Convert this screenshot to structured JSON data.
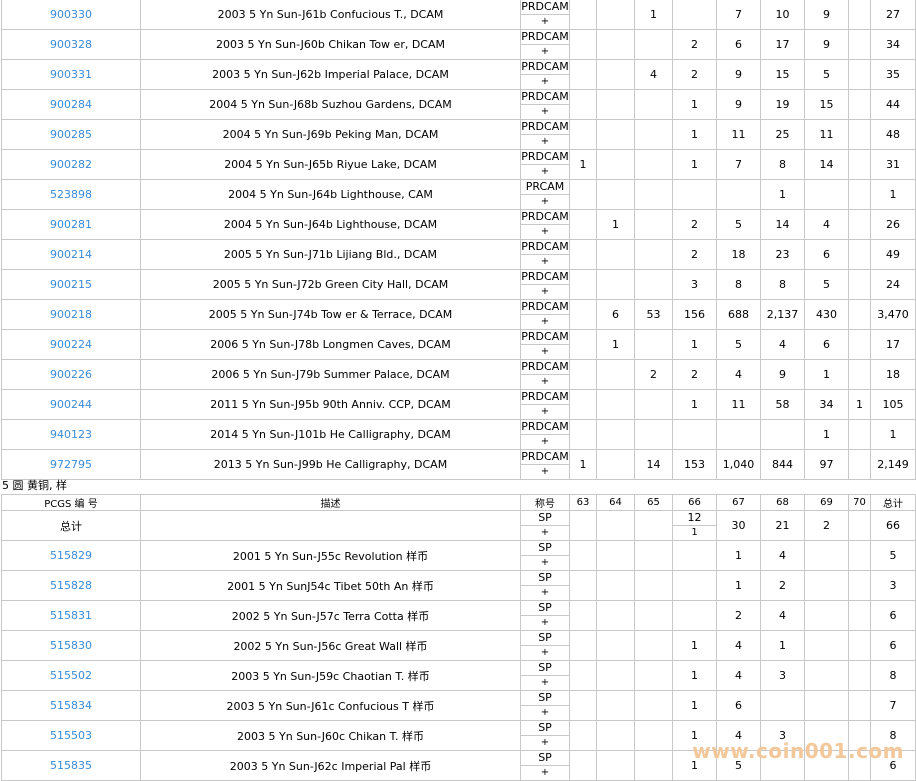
{
  "table1": {
    "rows": [
      {
        "pcgs": "900330",
        "desc": "2003 5 Yn Sun-J61b Confucious T., DCAM",
        "grade": "PRDCAM",
        "plus": "+",
        "c63": "",
        "c64": "",
        "c65": "1",
        "c66": "",
        "c67": "7",
        "c68": "10",
        "c69": "9",
        "c70": "",
        "total": "27"
      },
      {
        "pcgs": "900328",
        "desc": "2003 5 Yn Sun-J60b Chikan Tow er, DCAM",
        "grade": "PRDCAM",
        "plus": "+",
        "c63": "",
        "c64": "",
        "c65": "",
        "c66": "2",
        "c67": "6",
        "c68": "17",
        "c69": "9",
        "c70": "",
        "total": "34"
      },
      {
        "pcgs": "900331",
        "desc": "2003 5 Yn Sun-J62b Imperial Palace, DCAM",
        "grade": "PRDCAM",
        "plus": "+",
        "c63": "",
        "c64": "",
        "c65": "4",
        "c66": "2",
        "c67": "9",
        "c68": "15",
        "c69": "5",
        "c70": "",
        "total": "35"
      },
      {
        "pcgs": "900284",
        "desc": "2004 5 Yn Sun-J68b Suzhou Gardens, DCAM",
        "grade": "PRDCAM",
        "plus": "+",
        "c63": "",
        "c64": "",
        "c65": "",
        "c66": "1",
        "c67": "9",
        "c68": "19",
        "c69": "15",
        "c70": "",
        "total": "44"
      },
      {
        "pcgs": "900285",
        "desc": "2004 5 Yn Sun-J69b Peking Man, DCAM",
        "grade": "PRDCAM",
        "plus": "+",
        "c63": "",
        "c64": "",
        "c65": "",
        "c66": "1",
        "c67": "11",
        "c68": "25",
        "c69": "11",
        "c70": "",
        "total": "48"
      },
      {
        "pcgs": "900282",
        "desc": "2004 5 Yn Sun-J65b Riyue Lake, DCAM",
        "grade": "PRDCAM",
        "plus": "+",
        "c63": "1",
        "c64": "",
        "c65": "",
        "c66": "1",
        "c67": "7",
        "c68": "8",
        "c69": "14",
        "c70": "",
        "total": "31"
      },
      {
        "pcgs": "523898",
        "desc": "2004 5 Yn Sun-J64b Lighthouse, CAM",
        "grade": "PRCAM",
        "plus": "+",
        "c63": "",
        "c64": "",
        "c65": "",
        "c66": "",
        "c67": "",
        "c68": "1",
        "c69": "",
        "c70": "",
        "total": "1"
      },
      {
        "pcgs": "900281",
        "desc": "2004 5 Yn Sun-J64b Lighthouse, DCAM",
        "grade": "PRDCAM",
        "plus": "+",
        "c63": "",
        "c64": "1",
        "c65": "",
        "c66": "2",
        "c67": "5",
        "c68": "14",
        "c69": "4",
        "c70": "",
        "total": "26"
      },
      {
        "pcgs": "900214",
        "desc": "2005 5 Yn Sun-J71b Lijiang Bld., DCAM",
        "grade": "PRDCAM",
        "plus": "+",
        "c63": "",
        "c64": "",
        "c65": "",
        "c66": "2",
        "c67": "18",
        "c68": "23",
        "c69": "6",
        "c70": "",
        "total": "49"
      },
      {
        "pcgs": "900215",
        "desc": "2005 5 Yn Sun-J72b Green City Hall, DCAM",
        "grade": "PRDCAM",
        "plus": "+",
        "c63": "",
        "c64": "",
        "c65": "",
        "c66": "3",
        "c67": "8",
        "c68": "8",
        "c69": "5",
        "c70": "",
        "total": "24"
      },
      {
        "pcgs": "900218",
        "desc": "2005 5 Yn Sun-J74b Tow er & Terrace, DCAM",
        "grade": "PRDCAM",
        "plus": "+",
        "c63": "",
        "c64": "6",
        "c65": "53",
        "c66": "156",
        "c67": "688",
        "c68": "2,137",
        "c69": "430",
        "c70": "",
        "total": "3,470"
      },
      {
        "pcgs": "900224",
        "desc": "2006 5 Yn Sun-J78b Longmen Caves, DCAM",
        "grade": "PRDCAM",
        "plus": "+",
        "c63": "",
        "c64": "1",
        "c65": "",
        "c66": "1",
        "c67": "5",
        "c68": "4",
        "c69": "6",
        "c70": "",
        "total": "17"
      },
      {
        "pcgs": "900226",
        "desc": "2006 5 Yn Sun-J79b Summer Palace, DCAM",
        "grade": "PRDCAM",
        "plus": "+",
        "c63": "",
        "c64": "",
        "c65": "2",
        "c66": "2",
        "c67": "4",
        "c68": "9",
        "c69": "1",
        "c70": "",
        "total": "18"
      },
      {
        "pcgs": "900244",
        "desc": "2011 5 Yn Sun-J95b 90th Anniv. CCP, DCAM",
        "grade": "PRDCAM",
        "plus": "+",
        "c63": "",
        "c64": "",
        "c65": "",
        "c66": "1",
        "c67": "11",
        "c68": "58",
        "c69": "34",
        "c70": "1",
        "total": "105"
      },
      {
        "pcgs": "940123",
        "desc": "2014 5 Yn Sun-J101b He Calligraphy, DCAM",
        "grade": "PRDCAM",
        "plus": "+",
        "c63": "",
        "c64": "",
        "c65": "",
        "c66": "",
        "c67": "",
        "c68": "",
        "c69": "1",
        "c70": "",
        "total": "1"
      },
      {
        "pcgs": "972795",
        "desc": "2013 5 Yn Sun-J99b He Calligraphy, DCAM",
        "grade": "PRDCAM",
        "plus": "+",
        "c63": "1",
        "c64": "",
        "c65": "14",
        "c66": "153",
        "c67": "1,040",
        "c68": "844",
        "c69": "97",
        "c70": "",
        "total": "2,149"
      }
    ]
  },
  "section_title": "5 圆 黄铜, 样",
  "table2": {
    "headers": {
      "pcgs": "PCGS 编 号",
      "desc": "描述",
      "grade": "称号",
      "c63": "63",
      "c64": "64",
      "c65": "65",
      "c66": "66",
      "c67": "67",
      "c68": "68",
      "c69": "69",
      "c70": "70",
      "total": "总计"
    },
    "summary": {
      "label": "总计",
      "grade": "SP",
      "plus": "+",
      "c66_top": "12",
      "c66_bottom": "1",
      "c67": "30",
      "c68": "21",
      "c69": "2",
      "total": "66"
    },
    "rows": [
      {
        "pcgs": "515829",
        "desc": "2001 5 Yn Sun-J55c Revolution 样币",
        "grade": "SP",
        "plus": "+",
        "c63": "",
        "c64": "",
        "c65": "",
        "c66": "",
        "c67": "1",
        "c68": "4",
        "c69": "",
        "c70": "",
        "total": "5"
      },
      {
        "pcgs": "515828",
        "desc": "2001 5 Yn SunJ54c Tibet 50th An 样币",
        "grade": "SP",
        "plus": "+",
        "c63": "",
        "c64": "",
        "c65": "",
        "c66": "",
        "c67": "1",
        "c68": "2",
        "c69": "",
        "c70": "",
        "total": "3"
      },
      {
        "pcgs": "515831",
        "desc": "2002 5 Yn Sun-J57c Terra Cotta 样币",
        "grade": "SP",
        "plus": "+",
        "c63": "",
        "c64": "",
        "c65": "",
        "c66": "",
        "c67": "2",
        "c68": "4",
        "c69": "",
        "c70": "",
        "total": "6"
      },
      {
        "pcgs": "515830",
        "desc": "2002 5 Yn Sun-J56c Great Wall 样币",
        "grade": "SP",
        "plus": "+",
        "c63": "",
        "c64": "",
        "c65": "",
        "c66": "1",
        "c67": "4",
        "c68": "1",
        "c69": "",
        "c70": "",
        "total": "6"
      },
      {
        "pcgs": "515502",
        "desc": "2003 5 Yn Sun-J59c Chaotian T. 样币",
        "grade": "SP",
        "plus": "+",
        "c63": "",
        "c64": "",
        "c65": "",
        "c66": "1",
        "c67": "4",
        "c68": "3",
        "c69": "",
        "c70": "",
        "total": "8"
      },
      {
        "pcgs": "515834",
        "desc": "2003 5 Yn Sun-J61c Confucious T 样币",
        "grade": "SP",
        "plus": "+",
        "c63": "",
        "c64": "",
        "c65": "",
        "c66": "1",
        "c67": "6",
        "c68": "",
        "c69": "",
        "c70": "",
        "total": "7"
      },
      {
        "pcgs": "515503",
        "desc": "2003 5 Yn Sun-J60c Chikan T. 样币",
        "grade": "SP",
        "plus": "+",
        "c63": "",
        "c64": "",
        "c65": "",
        "c66": "1",
        "c67": "4",
        "c68": "3",
        "c69": "",
        "c70": "",
        "total": "8"
      },
      {
        "pcgs": "515835",
        "desc": "2003 5 Yn Sun-J62c Imperial Pal 样币",
        "grade": "SP",
        "plus": "+",
        "c63": "",
        "c64": "",
        "c65": "",
        "c66": "1",
        "c67": "5",
        "c68": "",
        "c69": "",
        "c70": "",
        "total": "6"
      }
    ]
  },
  "watermark": "www.coin001.com"
}
